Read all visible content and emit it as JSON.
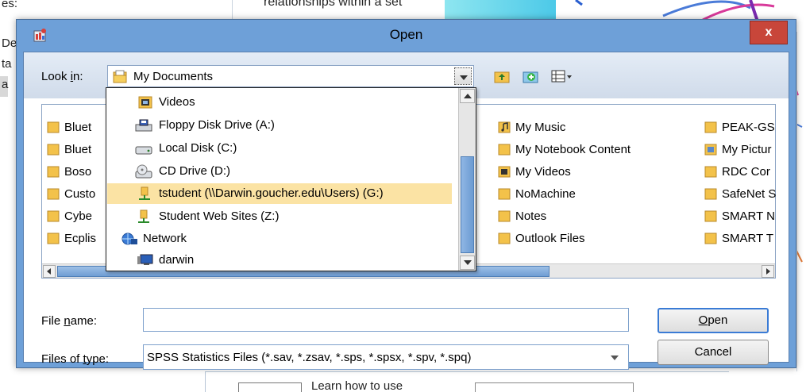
{
  "background": {
    "left_texts": [
      "es:",
      "De",
      "ta",
      "a"
    ],
    "top_text": "relationships within a set",
    "bottom_text": "Learn how to use"
  },
  "dialog": {
    "title": "Open",
    "close_label": "x"
  },
  "lookin": {
    "label_pre": "Look ",
    "label_key": "i",
    "label_post": "n:",
    "value": "My Documents"
  },
  "files": {
    "col1": [
      "Bluet",
      "Bluet",
      "Boso",
      "Custo",
      "Cybe",
      "Ecplis"
    ],
    "col2": [
      "My Music",
      "My Notebook Content",
      "My Videos",
      "NoMachine",
      "Notes",
      "Outlook Files"
    ],
    "col3": [
      "PEAK-GS",
      "My Pictur",
      "RDC Cor",
      "SafeNet S",
      "SMART N",
      "SMART T"
    ]
  },
  "dropdown": {
    "items": [
      {
        "label": "Videos",
        "icon": "videos-folder-icon"
      },
      {
        "label": "Floppy Disk Drive (A:)",
        "icon": "floppy-drive-icon"
      },
      {
        "label": "Local Disk (C:)",
        "icon": "hard-disk-icon"
      },
      {
        "label": "CD Drive (D:)",
        "icon": "cd-drive-icon"
      },
      {
        "label": "tstudent (\\\\Darwin.goucher.edu\\Users) (G:)",
        "icon": "network-drive-icon"
      },
      {
        "label": "Student Web Sites (Z:)",
        "icon": "network-drive-icon"
      },
      {
        "label": "Network",
        "icon": "network-icon"
      },
      {
        "label": "darwin",
        "icon": "computer-icon"
      }
    ],
    "selected_index": 4
  },
  "filename": {
    "label_pre": "File ",
    "label_key": "n",
    "label_post": "ame:",
    "value": ""
  },
  "filetype": {
    "label_pre": "Files of ",
    "label_key": "t",
    "label_post": "ype:",
    "value": "SPSS Statistics Files (*.sav, *.zsav, *.sps, *.spsx, *.spv, *.spq)"
  },
  "buttons": {
    "open_key": "O",
    "open_rest": "pen",
    "cancel": "Cancel"
  },
  "colors": {
    "frame": "#6ea0d8",
    "close": "#c8463a",
    "selection": "#fbe3a4",
    "folder": "#f3c24a"
  }
}
